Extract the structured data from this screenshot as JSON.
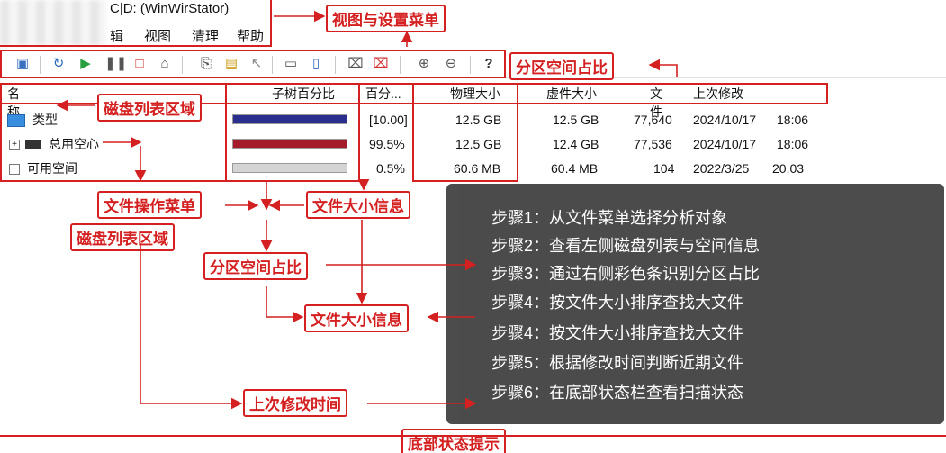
{
  "window": {
    "title": "C|D: (WinWirStator)"
  },
  "menu": {
    "items": [
      "辑",
      "视图",
      "清理",
      "帮助"
    ]
  },
  "columns": {
    "name": "名称",
    "subtree_percent": "子树百分比",
    "percent": "百分...",
    "physical_size": "物理大小",
    "logical_size": "虚件大小",
    "files": "文件",
    "last_modified": "上次修改"
  },
  "rows": [
    {
      "name": "类型",
      "percent": "[10.00]",
      "physical": "12.5 GB",
      "logical": "12.5 GB",
      "files": "77,640",
      "date": "2024/10/17",
      "time": "18:06"
    },
    {
      "name": "总用空心",
      "percent": "99.5%",
      "physical": "12.5 GB",
      "logical": "12.4 GB",
      "files": "77,536",
      "date": "2024/10/17",
      "time": "18:06"
    },
    {
      "name": "可用空间",
      "percent": "0.5%",
      "physical": "60.6 MB",
      "logical": "60.4 MB",
      "files": "104",
      "date": "2022/3/25",
      "time": "20.03"
    }
  ],
  "bars": [
    {
      "fill": 1.0,
      "color": "#2a2e8c"
    },
    {
      "fill": 1.0,
      "color": "#a41c2c"
    },
    {
      "fill": 1.0,
      "color": "#d4d4d4"
    }
  ],
  "annotations": {
    "view_settings_menu": "视图与设置菜单",
    "partition_ratio_top": "分区空间占比",
    "disk_list_area_1": "磁盘列表区域",
    "file_op_menu": "文件操作菜单",
    "file_size_info_1": "文件大小信息",
    "disk_list_area_2": "磁盘列表区域",
    "partition_ratio_mid": "分区空间占比",
    "file_size_info_2": "文件大小信息",
    "last_modified_time": "上次修改时间",
    "status_hint": "底部状态提示"
  },
  "steps": [
    "步骤1：从文件菜单选择分析对象",
    "步骤2：查看左侧磁盘列表与空间信息",
    "步骤3：通过右侧彩色条识别分区占比",
    "步骤4：按文件大小排序查找大文件",
    "步骤4：按文件大小排序查找大文件",
    "步骤5：根据修改时间判断近期文件",
    "步骤6：在底部状态栏查看扫描状态"
  ],
  "colors": {
    "annotation_red": "#d42020",
    "panel_bg": "#424242"
  }
}
